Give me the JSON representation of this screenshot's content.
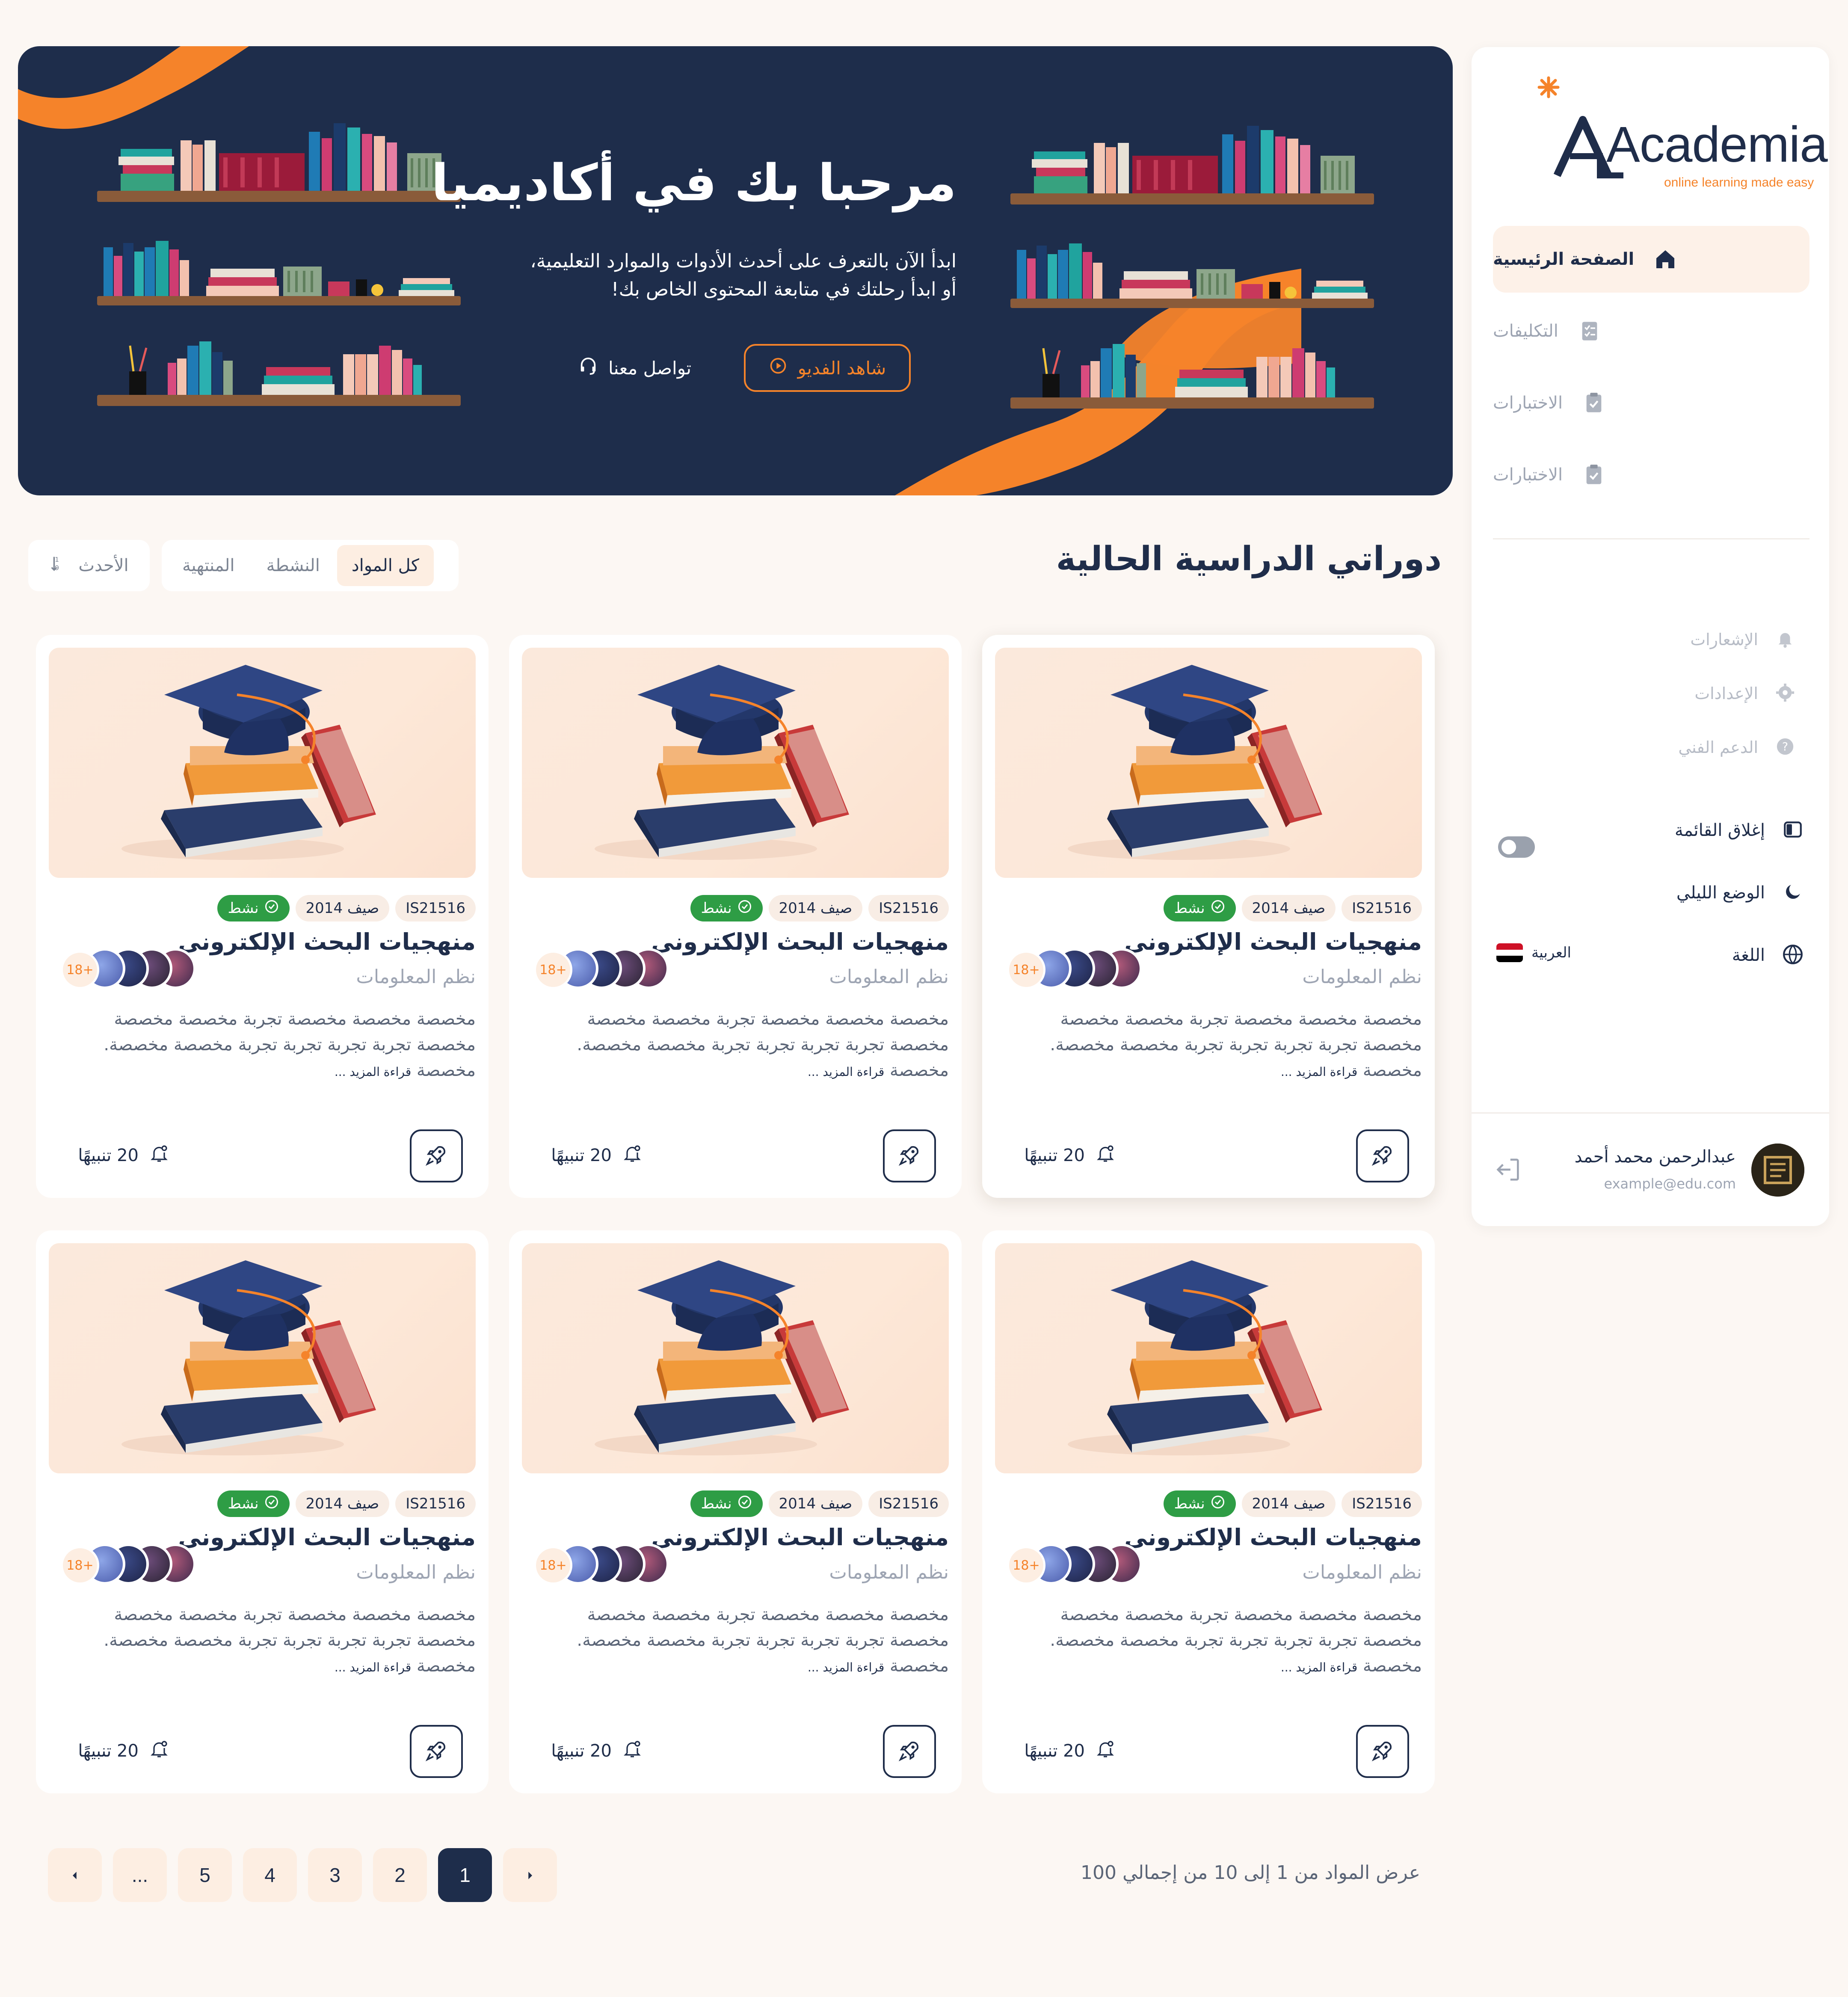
{
  "brand": {
    "name": "Academia",
    "tagline": "online learning made easy",
    "accent": "#f5832a",
    "navy": "#1e2d4b"
  },
  "sidebar": {
    "nav": [
      {
        "label": "الصفحة الرئيسية",
        "icon": "home-icon",
        "active": true
      },
      {
        "label": "التكليفات",
        "icon": "assignment-icon",
        "active": false
      },
      {
        "label": "الاختبارات",
        "icon": "quiz-clipboard-icon",
        "active": false
      },
      {
        "label": "الاختبارات",
        "icon": "quiz-clipboard-icon",
        "active": false
      }
    ],
    "secondary": [
      {
        "label": "الإشعارات",
        "icon": "bell-icon"
      },
      {
        "label": "الإعدادات",
        "icon": "gear-icon"
      },
      {
        "label": "الدعم الفني",
        "icon": "help-icon"
      }
    ],
    "close_menu": "إغلاق القائمة",
    "dark_mode": "الوضع الليلي",
    "language_label": "اللغة",
    "language_value": "العربية",
    "user": {
      "name": "عبدالرحمن محمد أحمد",
      "email": "example@edu.com"
    }
  },
  "hero": {
    "title": "مرحبا بك في أكاديميا",
    "subtitle_line1": "ابدأ الآن بالتعرف على أحدث الأدوات والموارد التعليمية،",
    "subtitle_line2": "أو ابدأ رحلتك في متابعة المحتوى الخاص بك!",
    "watch_video": "شاهد الفديو",
    "contact": "تواصل معنا"
  },
  "section": {
    "title": "دوراتي الدراسية الحالية",
    "tabs": [
      "كل المواد",
      "النشطة",
      "المنتهية"
    ],
    "sort_label": "الأحدث"
  },
  "course": {
    "code": "IS21516",
    "term": "صيف 2014",
    "status": "نشط",
    "title": "منهجيات البحث الإلكتروني",
    "department": "نظم المعلومات",
    "desc_line1": "مخصصة مخصصة مخصصة تجربة مخصصة مخصصة",
    "desc_line2": "مخصصة تجربة تجربة تجربة تجربة مخصصة مخصصة.",
    "desc_line3": "مخصصة",
    "read_more": "قراءة المزيد ...",
    "age_badge": "18+",
    "alerts": "20 تنبيهًا"
  },
  "pagination": {
    "pages": [
      "1",
      "2",
      "3",
      "4",
      "5",
      "..."
    ],
    "current": "1",
    "info": "عرض المواد من 1 إلى 10 من إجمالي 100"
  }
}
